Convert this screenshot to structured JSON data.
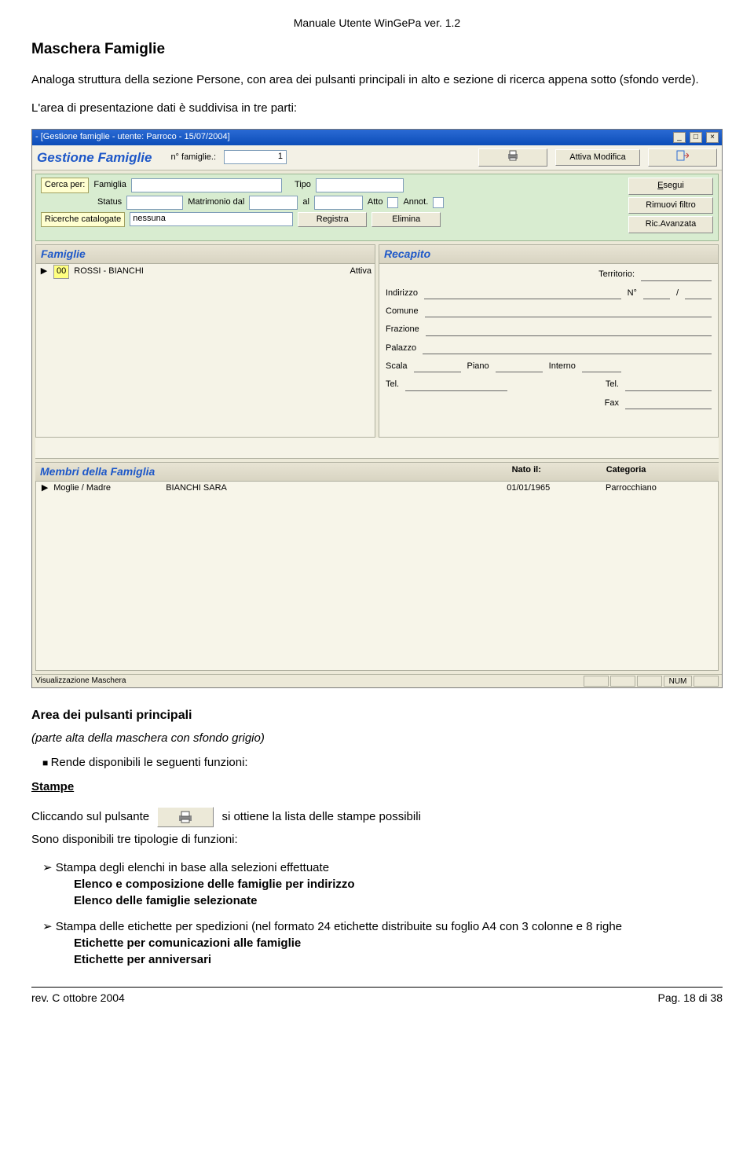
{
  "doc": {
    "header": "Manuale Utente WinGePa ver. 1.2",
    "title": "Maschera Famiglie",
    "intro": "Analoga struttura della sezione Persone, con area dei pulsanti principali in alto e sezione di ricerca appena sotto (sfondo verde).",
    "intro2": "L'area di presentazione dati è suddivisa in tre parti:",
    "area_title": "Area dei pulsanti principali",
    "area_sub": "(parte alta della maschera con sfondo grigio)",
    "bullet1": "Rende disponibili le seguenti funzioni:",
    "stampe_title": "Stampe",
    "stampe_line_a": "Cliccando sul pulsante",
    "stampe_line_b": "si ottiene la lista delle stampe possibili",
    "stampe_line2": "Sono disponibili tre tipologie di funzioni:",
    "arrow1": "Stampa degli elenchi in base alla selezioni effettuate",
    "arrow1_b1": "Elenco e composizione delle famiglie per indirizzo",
    "arrow1_b2": "Elenco delle famiglie selezionate",
    "arrow2": "Stampa delle etichette per spedizioni (nel formato 24 etichette distribuite su foglio A4 con 3 colonne e 8 righe",
    "arrow2_b1": "Etichette per comunicazioni alle famiglie",
    "arrow2_b2": "Etichette per anniversari",
    "footer_left": "rev. C  ottobre 2004",
    "footer_right": "Pag. 18 di 38"
  },
  "shot": {
    "titlebar": " - [Gestione famiglie - utente: Parroco - 15/07/2004]",
    "app_title": "Gestione Famiglie",
    "n_fam_label": "n° famiglie.:",
    "n_fam_value": "1",
    "btn_attiva": "Attiva Modifica",
    "search": {
      "cerca": "Cerca per:",
      "famiglia": "Famiglia",
      "status": "Status",
      "matrimonio": "Matrimonio  dal",
      "al": "al",
      "tipo": "Tipo",
      "atto": "Atto",
      "annot": "Annot.",
      "ricerche": "Ricerche catalogate",
      "nessuna": "nessuna",
      "registra": "Registra",
      "elimina": "Elimina",
      "esegui": "Esegui",
      "rimuovi": "Rimuovi filtro",
      "avanzata": "Ric.Avanzata"
    },
    "fam": {
      "head": "Famiglie",
      "code": "00",
      "name": "ROSSI - BIANCHI",
      "attiva": "Attiva"
    },
    "recap": {
      "head": "Recapito",
      "territorio": "Territorio:",
      "indirizzo": "Indirizzo",
      "n": "N°",
      "slash": "/",
      "comune": "Comune",
      "frazione": "Frazione",
      "palazzo": "Palazzo",
      "scala": "Scala",
      "piano": "Piano",
      "interno": "Interno",
      "tel": "Tel.",
      "tel2": "Tel.",
      "fax": "Fax"
    },
    "members": {
      "head": "Membri della Famiglia",
      "nato": "Nato il:",
      "cat": "Categoria",
      "role": "Moglie / Madre",
      "name": "BIANCHI  SARA",
      "date": "01/01/1965",
      "catval": "Parrocchiano"
    },
    "status": {
      "label": "Visualizzazione Maschera",
      "num": "NUM"
    }
  }
}
